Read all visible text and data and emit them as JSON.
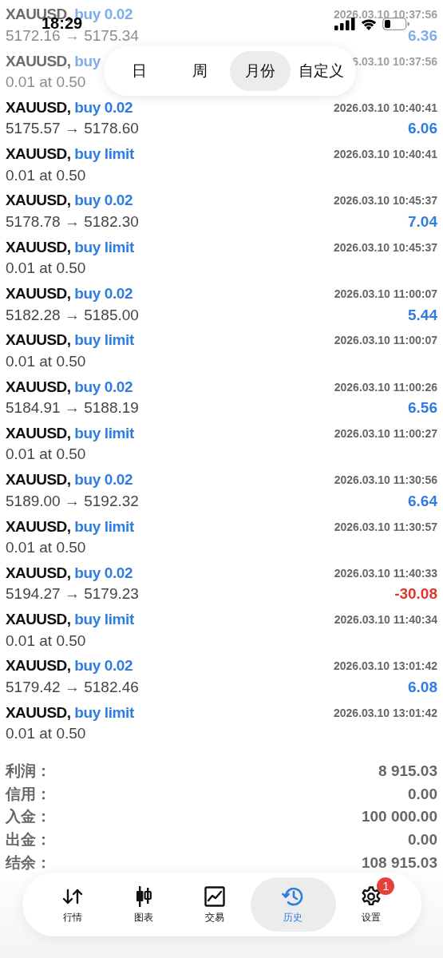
{
  "status_bar": {
    "time": "18:29"
  },
  "period_tabs": [
    {
      "label": "日",
      "selected": false
    },
    {
      "label": "周",
      "selected": false
    },
    {
      "label": "月份",
      "selected": true
    },
    {
      "label": "自定义",
      "selected": false
    }
  ],
  "deals": [
    {
      "symbol": "XAUUSD,",
      "order": "buy 0.02",
      "time": "2026.03.10 10:37:56",
      "detail": "5172.16 → 5175.34",
      "profit": "6.36",
      "loss": false
    },
    {
      "symbol": "XAUUSD,",
      "order": "buy",
      "time": "6.03.10 10:37:56",
      "detail": "0.01 at 0.50"
    },
    {
      "symbol": "XAUUSD,",
      "order": "buy 0.02",
      "time": "2026.03.10 10:40:41",
      "detail": "5175.57 → 5178.60",
      "profit": "6.06",
      "loss": false
    },
    {
      "symbol": "XAUUSD,",
      "order": "buy limit",
      "time": "2026.03.10 10:40:41",
      "detail": "0.01 at 0.50"
    },
    {
      "symbol": "XAUUSD,",
      "order": "buy 0.02",
      "time": "2026.03.10 10:45:37",
      "detail": "5178.78 → 5182.30",
      "profit": "7.04",
      "loss": false
    },
    {
      "symbol": "XAUUSD,",
      "order": "buy limit",
      "time": "2026.03.10 10:45:37",
      "detail": "0.01 at 0.50"
    },
    {
      "symbol": "XAUUSD,",
      "order": "buy 0.02",
      "time": "2026.03.10 11:00:07",
      "detail": "5182.28 → 5185.00",
      "profit": "5.44",
      "loss": false
    },
    {
      "symbol": "XAUUSD,",
      "order": "buy limit",
      "time": "2026.03.10 11:00:07",
      "detail": "0.01 at 0.50"
    },
    {
      "symbol": "XAUUSD,",
      "order": "buy 0.02",
      "time": "2026.03.10 11:00:26",
      "detail": "5184.91 → 5188.19",
      "profit": "6.56",
      "loss": false
    },
    {
      "symbol": "XAUUSD,",
      "order": "buy limit",
      "time": "2026.03.10 11:00:27",
      "detail": "0.01 at 0.50"
    },
    {
      "symbol": "XAUUSD,",
      "order": "buy 0.02",
      "time": "2026.03.10 11:30:56",
      "detail": "5189.00 → 5192.32",
      "profit": "6.64",
      "loss": false
    },
    {
      "symbol": "XAUUSD,",
      "order": "buy limit",
      "time": "2026.03.10 11:30:57",
      "detail": "0.01 at 0.50"
    },
    {
      "symbol": "XAUUSD,",
      "order": "buy 0.02",
      "time": "2026.03.10 11:40:33",
      "detail": "5194.27 → 5179.23",
      "profit": "-30.08",
      "loss": true
    },
    {
      "symbol": "XAUUSD,",
      "order": "buy limit",
      "time": "2026.03.10 11:40:34",
      "detail": "0.01 at 0.50"
    },
    {
      "symbol": "XAUUSD,",
      "order": "buy 0.02",
      "time": "2026.03.10 13:01:42",
      "detail": "5179.42 → 5182.46",
      "profit": "6.08",
      "loss": false
    },
    {
      "symbol": "XAUUSD,",
      "order": "buy limit",
      "time": "2026.03.10 13:01:42",
      "detail": "0.01 at 0.50"
    }
  ],
  "summary": [
    {
      "label": "利润：",
      "value": "8 915.03"
    },
    {
      "label": "信用：",
      "value": "0.00"
    },
    {
      "label": "入金：",
      "value": "100 000.00"
    },
    {
      "label": "出金：",
      "value": "0.00"
    },
    {
      "label": "结余：",
      "value": "108 915.03"
    }
  ],
  "tab_bar": [
    {
      "kind": "quotes",
      "label": "行情",
      "selected": false
    },
    {
      "kind": "chart",
      "label": "图表",
      "selected": false
    },
    {
      "kind": "trade",
      "label": "交易",
      "selected": false
    },
    {
      "kind": "history",
      "label": "历史",
      "selected": true
    },
    {
      "kind": "settings",
      "label": "设置",
      "selected": false,
      "badge": "1"
    }
  ]
}
